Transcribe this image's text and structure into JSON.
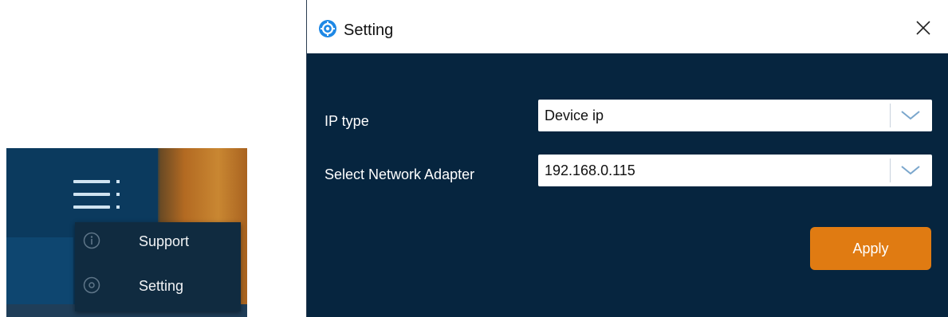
{
  "menu": {
    "items": [
      {
        "label": "Support",
        "icon": "info-icon"
      },
      {
        "label": "Setting",
        "icon": "gear-icon"
      }
    ]
  },
  "dialog": {
    "title": "Setting",
    "fields": [
      {
        "label": "IP type",
        "value": "Device ip"
      },
      {
        "label": "Select Network Adapter",
        "value": "192.168.0.115"
      }
    ],
    "apply_label": "Apply"
  },
  "colors": {
    "dialog_background": "#06253f",
    "accent_button": "#e07b12",
    "menu_background": "#102b40",
    "app_icon": "#1e88e5"
  }
}
